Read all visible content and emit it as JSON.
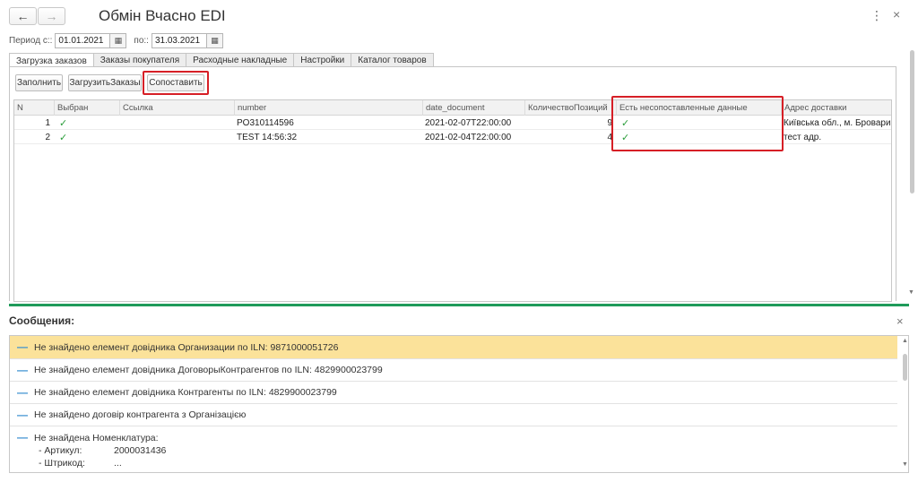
{
  "window": {
    "title": "Обмін Вчасно EDI",
    "back_icon": "←",
    "forward_icon": "→",
    "more_icon": "⋮",
    "close_icon": "×"
  },
  "period": {
    "from_label": "Период с::",
    "from_value": "01.01.2021",
    "to_label": "по::",
    "to_value": "31.03.2021"
  },
  "tabs": [
    {
      "label": "Загрузка заказов",
      "active": true
    },
    {
      "label": "Заказы покупателя",
      "active": false
    },
    {
      "label": "Расходные накладные",
      "active": false
    },
    {
      "label": "Настройки",
      "active": false
    },
    {
      "label": "Каталог товаров",
      "active": false
    }
  ],
  "toolbar": {
    "fill_label": "Заполнить",
    "load_label": "ЗагрузитьЗаказы",
    "match_label": "Сопоставить"
  },
  "grid": {
    "columns": [
      "N",
      "Выбран",
      "Ссылка",
      "number",
      "date_document",
      "КоличествоПозиций",
      "Есть несопоставленные данные",
      "Адрес доставки"
    ],
    "rows": [
      {
        "n": "1",
        "checked": "✓",
        "link": "",
        "number": "PO310114596",
        "date": "2021-02-07T22:00:00",
        "qty": "9",
        "unmatched": "✓",
        "address": "Київська обл., м. Бровари,"
      },
      {
        "n": "2",
        "checked": "✓",
        "link": "",
        "number": "TEST 14:56:32",
        "date": "2021-02-04T22:00:00",
        "qty": "4",
        "unmatched": "✓",
        "address": "тест адр."
      }
    ]
  },
  "messages": {
    "title": "Сообщения:",
    "close_icon": "×",
    "items": [
      {
        "text": "Не знайдено елемент довідника Организации по ILN: 9871000051726",
        "highlighted": true
      },
      {
        "text": "Не знайдено елемент довідника ДоговорыКонтрагентов по ILN: 4829900023799",
        "highlighted": false
      },
      {
        "text": "Не знайдено елемент довідника Контрагенты по ILN: 4829900023799",
        "highlighted": false
      },
      {
        "text": "Не знайдено договір контрагента  з Організацією",
        "highlighted": false
      },
      {
        "text": "Не знайдена Номенклатура:",
        "highlighted": false
      }
    ],
    "details": [
      {
        "label": "- Артикул:",
        "value": "2000031436"
      },
      {
        "label": "- Штрикод:",
        "value": "..."
      }
    ]
  },
  "colors": {
    "accent_green": "#1f9b5a",
    "highlight": "#fbe29a",
    "annotation_red": "#d61f26",
    "check_green": "#2a9d3a"
  }
}
